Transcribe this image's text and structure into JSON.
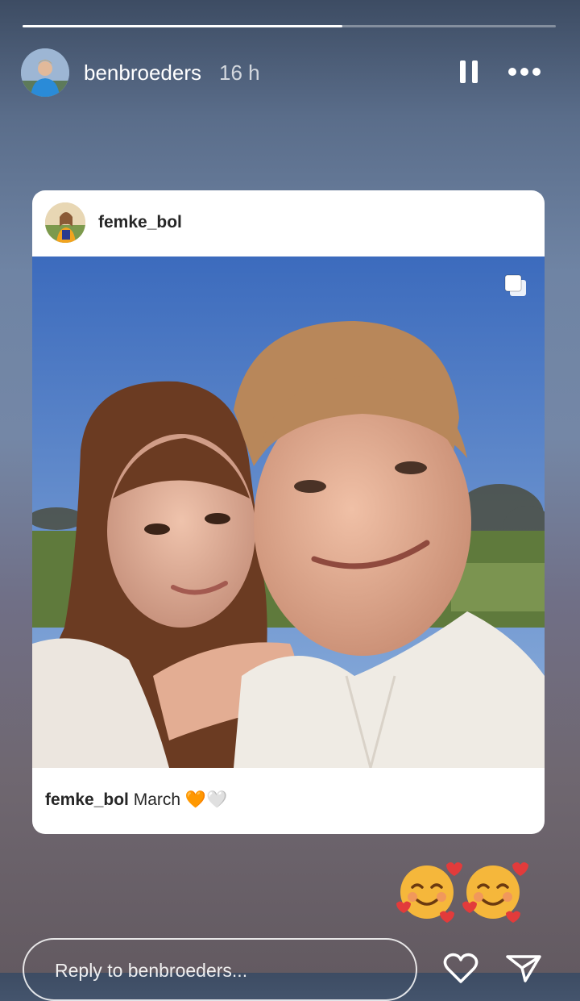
{
  "story": {
    "progress": 0.6,
    "username": "benbroeders",
    "time_ago": "16 h"
  },
  "post": {
    "username": "femke_bol",
    "caption_user": "femke_bol",
    "caption_text": "March",
    "caption_emojis": "🧡🤍"
  },
  "stickers": "☺️☺️",
  "reply": {
    "placeholder": "Reply to benbroeders..."
  },
  "icons": {
    "pause": "pause-icon",
    "more": "more-icon",
    "carousel": "carousel-icon",
    "heart": "heart-icon",
    "send": "send-icon"
  },
  "colors": {
    "card_bg": "#ffffff",
    "text_dark": "#262626",
    "accent_orange": "#f29a2e"
  }
}
